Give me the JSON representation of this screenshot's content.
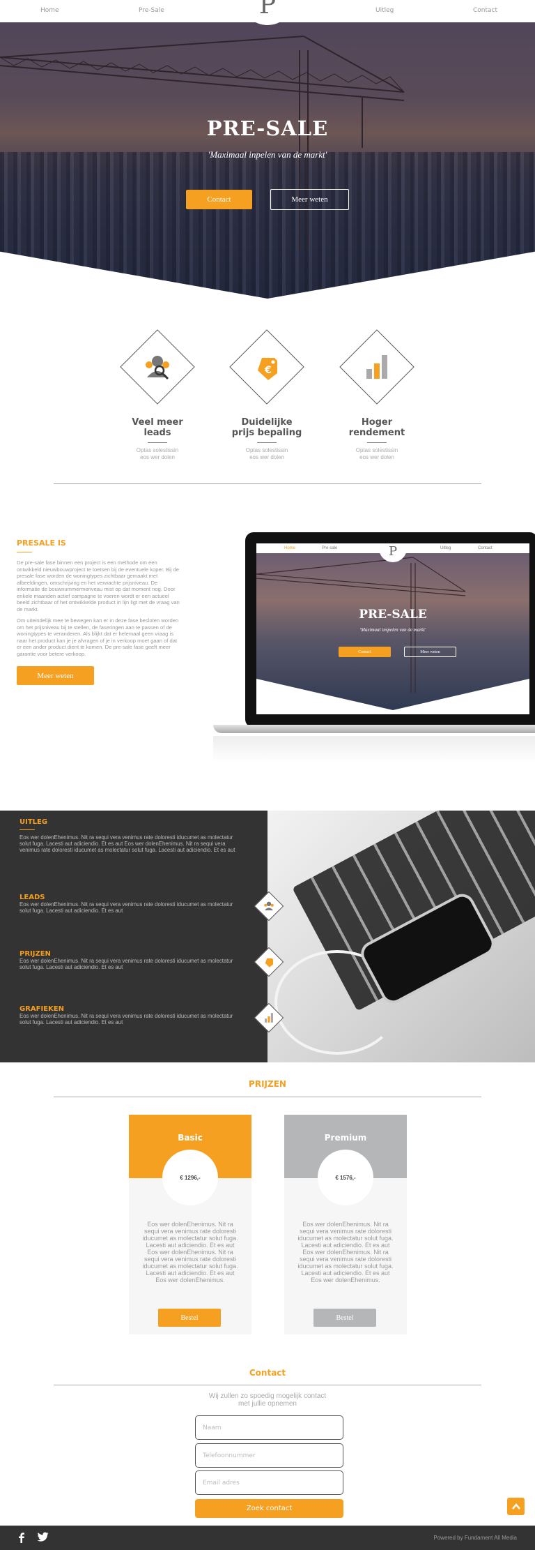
{
  "nav": {
    "home": "Home",
    "presale": "Pre-Sale",
    "uitleg": "Uitleg",
    "contact": "Contact"
  },
  "logo_letter": "P",
  "hero": {
    "title": "PRE-SALE",
    "tagline": "'Maximaal inpelen van de markt'",
    "contact_label": "Contact",
    "more_label": "Meer weten"
  },
  "features": [
    {
      "title_line1": "Veel meer",
      "title_line2": "leads",
      "text_line1": "Optas solestissin",
      "text_line2": "eos wer dolen",
      "icon": "users-search-icon"
    },
    {
      "title_line1": "Duidelijke",
      "title_line2": "prijs bepaling",
      "text_line1": "Optas solestissin",
      "text_line2": "eos wer dolen",
      "icon": "price-tag-icon"
    },
    {
      "title_line1": "Hoger",
      "title_line2": "rendement",
      "text_line1": "Optas solestissin",
      "text_line2": "eos wer dolen",
      "icon": "bar-chart-icon"
    }
  ],
  "presale": {
    "title": "PRESALE IS",
    "para1": "De pre-sale fase binnen een project is een methode om een ontwikkeld nieuwbouwproject te toetsen bij de eventuele koper. Bij de presale fase worden de woningtypes zichtbaar gemaakt met afbeeldingen, omschrijving en het verwachte prijsniveau. De informatie de bouwnummermeriveau mist op dat moment nog. Door enkele maanden actief campagne te voeren wordt er een actueel beeld zichtbaar of het ontwikkelde product in lijn ligt met de vraag van de markt.",
    "para2": "Om uiteindelijk mee te bewegen kan er in deze fase besloten worden om het prijsniveau bij te stellen, de faseringen aan te passen of de woningtypes te veranderen. Als blijkt dat er helemaal geen vraag is naar het product kan je je afvragen of je in verkoop moet gaan of dat er een ander product dient te komen. De pre-sale fase geeft meer garantie voor betere verkoop.",
    "button": "Meer weten"
  },
  "mockup": {
    "nav_home": "Home",
    "nav_presale": "Pre-sale",
    "nav_uitleg": "Uitleg",
    "nav_contact": "Contact",
    "logo": "P",
    "title": "PRE-SALE",
    "tagline": "'Maximaal inspelen van de markt'",
    "contact": "Contact",
    "more": "Meer weten"
  },
  "uitleg": {
    "title": "UITLEG",
    "text": "Eos wer dolenEhenimus. Nit ra sequi vera venimus rate doloresti iducumet as molectatur solut fuga. Lacesti aut adiciendio. Et es aut Eos wer dolenEhenimus. Nit ra sequi vera venimus rate doloresti iducumet as molectatur solut fuga. Lacesti aut adiciendio. Et es aut",
    "items": [
      {
        "title": "LEADS",
        "text": "Eos wer dolenEhenimus. Nit ra sequi vera venimus rate doloresti iducumet as molectatur solut fuga. Lacesti aut adiciendio. Et es aut",
        "icon": "users-search-icon"
      },
      {
        "title": "PRIJZEN",
        "text": "Eos wer dolenEhenimus. Nit ra sequi vera venimus rate doloresti iducumet as molectatur solut fuga. Lacesti aut adiciendio. Et es aut",
        "icon": "price-tag-icon"
      },
      {
        "title": "GRAFIEKEN",
        "text": "Eos wer dolenEhenimus. Nit ra sequi vera venimus rate doloresti iducumet as molectatur solut fuga. Lacesti aut adiciendio. Et es aut",
        "icon": "bar-chart-icon"
      }
    ]
  },
  "prijzen": {
    "title": "PRIJZEN",
    "plans": [
      {
        "name": "Basic",
        "price": "€ 1296,-",
        "desc": "Eos wer dolenEhenimus. Nit ra sequi vera venimus rate doloresti iducumet as molectatur solut fuga. Lacesti aut adiciendio. Et es aut Eos wer dolenEhenimus. Nit ra sequi vera venimus rate doloresti iducumet as molectatur solut fuga. Lacesti aut adiciendio. Et es aut Eos wer dolenEhenimus.",
        "button": "Bestel",
        "color": "#f5a020"
      },
      {
        "name": "Premium",
        "price": "€ 1576,-",
        "desc": "Eos wer dolenEhenimus. Nit ra sequi vera venimus rate doloresti iducumet as molectatur solut fuga. Lacesti aut adiciendio. Et es aut Eos wer dolenEhenimus. Nit ra sequi vera venimus rate doloresti iducumet as molectatur solut fuga. Lacesti aut adiciendio. Et es aut Eos wer dolenEhenimus.",
        "button": "Bestel",
        "color": "#b4b6b8"
      }
    ]
  },
  "contact": {
    "title": "Contact",
    "sub_line1": "Wij zullen zo spoedig mogelijk contact",
    "sub_line2": "met jullie opnemen",
    "name_placeholder": "Naam",
    "phone_placeholder": "Telefoonnummer",
    "email_placeholder": "Email adres",
    "submit": "Zoek contact"
  },
  "footer": {
    "powered": "Powered by Fundament All Media",
    "icons": [
      "facebook-icon",
      "twitter-icon"
    ]
  },
  "colors": {
    "accent": "#f5a020",
    "dark": "#333333",
    "grey": "#b4b6b8"
  }
}
